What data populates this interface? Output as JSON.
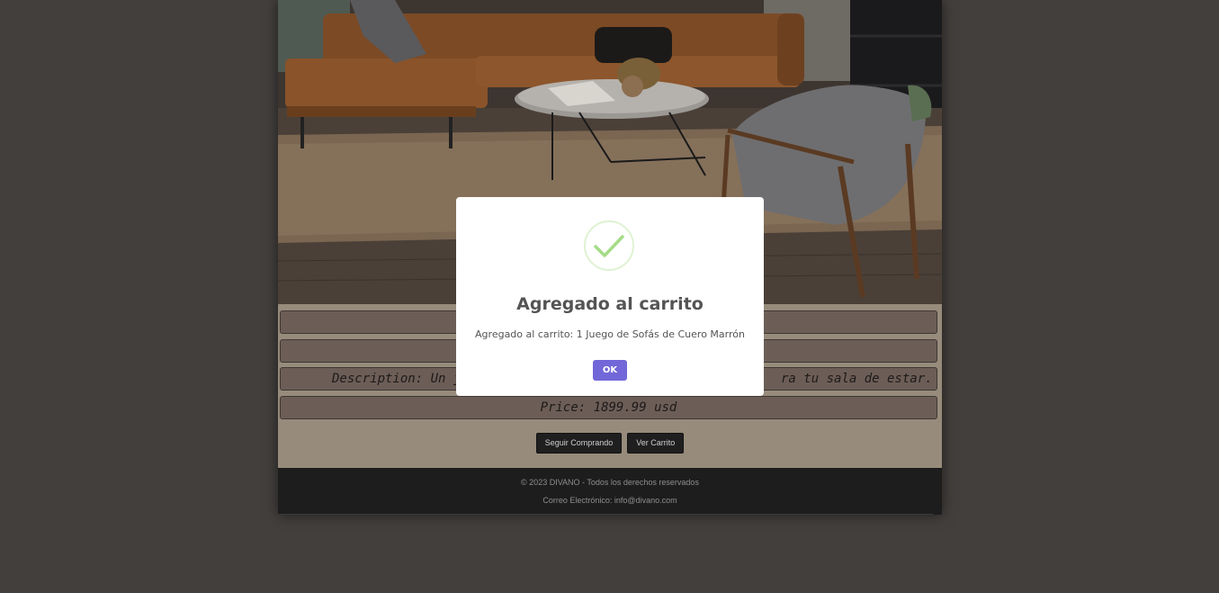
{
  "hero_image": {
    "alt": "Juego de Sofás de Cuero Marrón"
  },
  "product": {
    "name_partial": "",
    "category_partial": "",
    "description_left": "Description: Un jueg",
    "description_right": "ra tu sala de estar.",
    "price": "Price: 1899.99 usd"
  },
  "buttons": {
    "continue_shopping": "Seguir Comprando",
    "view_cart": "Ver Carrito"
  },
  "footer": {
    "copyright": "© 2023 DIVANO - Todos los derechos reservados",
    "email": "Correo Electrónico: info@divano.com"
  },
  "modal": {
    "icon": "check-icon",
    "title": "Agregado al carrito",
    "text": "Agregado al carrito: 1 Juego de Sofás de Cuero Marrón",
    "ok_label": "OK"
  },
  "colors": {
    "background": "#433f3d",
    "product_panel": "#978b7b",
    "info_box": "#6c5e57",
    "footer": "#1d1d1d",
    "modal_button": "#7267d8",
    "success": "#a5dc86"
  }
}
